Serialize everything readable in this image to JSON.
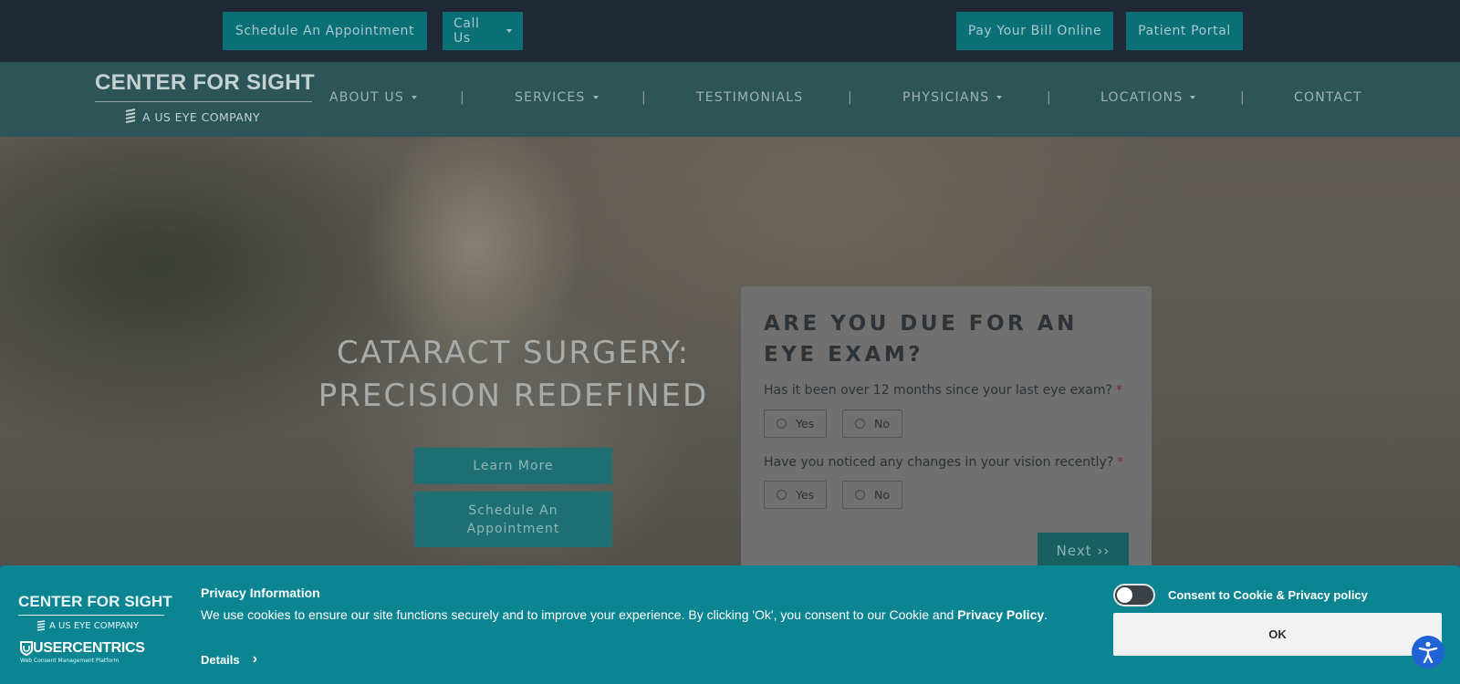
{
  "topbar": {
    "schedule_label": "Schedule An Appointment",
    "call_label": "Call Us",
    "pay_label": "Pay Your Bill Online",
    "portal_label": "Patient Portal"
  },
  "logo": {
    "main": "CENTER FOR SIGHT",
    "sub": "A US EYE COMPANY"
  },
  "nav": {
    "items": [
      "ABOUT US",
      "SERVICES",
      "TESTIMONIALS",
      "PHYSICIANS",
      "LOCATIONS",
      "CONTACT"
    ],
    "separator": "|"
  },
  "hero": {
    "title_line1": "CATARACT SURGERY:",
    "title_line2": "PRECISION REDEFINED",
    "learn_more": "Learn More",
    "schedule_line1": "Schedule An",
    "schedule_line2": "Appointment"
  },
  "form": {
    "title": "ARE YOU DUE FOR AN EYE EXAM?",
    "questions": [
      {
        "text": "Has it been over 12 months since your last eye exam?",
        "required": "*",
        "options": [
          "Yes",
          "No"
        ]
      },
      {
        "text": "Have you noticed any changes in your vision recently?",
        "required": "*",
        "options": [
          "Yes",
          "No"
        ]
      }
    ],
    "next_label": "Next ››"
  },
  "consent": {
    "logo_main": "CENTER FOR SIGHT",
    "logo_sub": "A US EYE COMPANY",
    "uc_main": "USERCENTRICS",
    "uc_sub": "Web Consent Management Platform",
    "title": "Privacy Information",
    "text_before": "We use cookies to ensure our site functions securely and to improve your experience. By clicking 'Ok', you consent to our Cookie and ",
    "policy_link": "Privacy Policy",
    "text_after": ".",
    "details_label": "Details",
    "toggle_label": "Consent to Cookie & Privacy policy",
    "ok_label": "OK"
  },
  "colors": {
    "top_bar_bg": "#1f2a36",
    "nav_bg": "#2d5456",
    "teal_button": "#0b6f76",
    "consent_bg": "#0a8591",
    "accessibility_blue": "#1f63d6"
  },
  "icons": {
    "logo_mark": "eye-company-logo-icon",
    "dropdown": "caret-down-icon",
    "details_chevron": "chevron-right-icon",
    "accessibility": "accessibility-icon"
  }
}
